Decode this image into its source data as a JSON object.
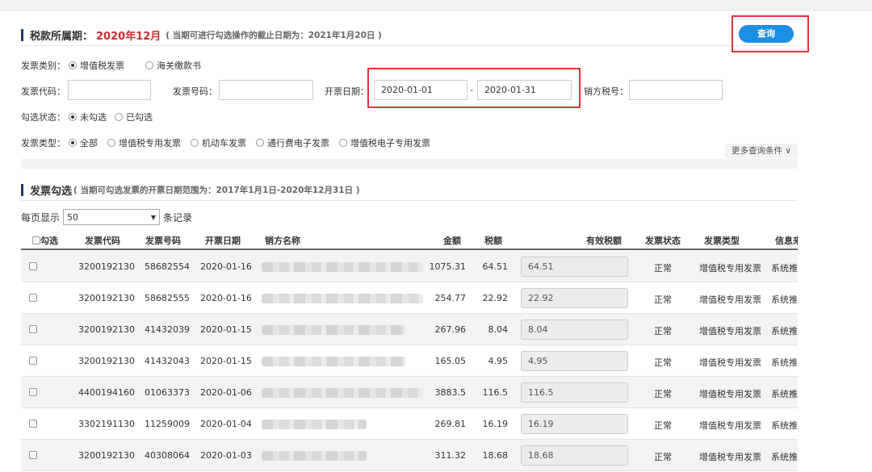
{
  "tax_period": {
    "label": "税款所属期：",
    "value": "2020年12月",
    "note": "( 当期可进行勾选操作的截止日期为：2021年1月20日 )"
  },
  "query_button": "查询",
  "filters": {
    "invoice_category": {
      "label": "发票类别：",
      "options": [
        "增值税发票",
        "海关缴款书"
      ],
      "selected": 0
    },
    "invoice_code": {
      "label": "发票代码：",
      "value": ""
    },
    "invoice_number": {
      "label": "发票号码：",
      "value": ""
    },
    "issue_date": {
      "label": "开票日期：",
      "from": "2020-01-01",
      "sep": "-",
      "to": "2020-01-31"
    },
    "seller_tax_id": {
      "label": "销方税号：",
      "value": ""
    },
    "check_status": {
      "label": "勾选状态：",
      "options": [
        "未勾选",
        "已勾选"
      ],
      "selected": 0
    },
    "invoice_type": {
      "label": "发票类型：",
      "options": [
        "全部",
        "增值税专用发票",
        "机动车发票",
        "通行费电子发票",
        "增值税电子专用发票"
      ],
      "selected": 0
    },
    "more_conditions": "更多查询条件 ∨"
  },
  "selection": {
    "title": "发票勾选",
    "note": "( 当期可勾选发票的开票日期范围为：2017年1月1日-2020年12月31日 )",
    "per_page_label": "每页显示",
    "per_page_value": "50",
    "per_page_suffix": "条记录"
  },
  "table": {
    "headers": [
      "勾选",
      "发票代码",
      "发票号码",
      "开票日期",
      "销方名称",
      "金额",
      "税额",
      "有效税额",
      "发票状态",
      "发票类型",
      "信息来"
    ],
    "rows": [
      {
        "code": "3200192130",
        "number": "58682554",
        "date": "2020-01-16",
        "amount": "1075.31",
        "tax": "64.51",
        "valid_tax": "64.51",
        "status": "正常",
        "type": "增值税专用发票",
        "source": "系统推"
      },
      {
        "code": "3200192130",
        "number": "58682555",
        "date": "2020-01-16",
        "amount": "254.77",
        "tax": "22.92",
        "valid_tax": "22.92",
        "status": "正常",
        "type": "增值税专用发票",
        "source": "系统推"
      },
      {
        "code": "3200192130",
        "number": "41432039",
        "date": "2020-01-15",
        "amount": "267.96",
        "tax": "8.04",
        "valid_tax": "8.04",
        "status": "正常",
        "type": "增值税专用发票",
        "source": "系统推"
      },
      {
        "code": "3200192130",
        "number": "41432043",
        "date": "2020-01-15",
        "amount": "165.05",
        "tax": "4.95",
        "valid_tax": "4.95",
        "status": "正常",
        "type": "增值税专用发票",
        "source": "系统推"
      },
      {
        "code": "4400194160",
        "number": "01063373",
        "date": "2020-01-06",
        "amount": "3883.5",
        "tax": "116.5",
        "valid_tax": "116.5",
        "status": "正常",
        "type": "增值税专用发票",
        "source": "系统推"
      },
      {
        "code": "3302191130",
        "number": "11259009",
        "date": "2020-01-04",
        "amount": "269.81",
        "tax": "16.19",
        "valid_tax": "16.19",
        "status": "正常",
        "type": "增值税专用发票",
        "source": "系统推"
      },
      {
        "code": "3200192130",
        "number": "40308064",
        "date": "2020-01-03",
        "amount": "311.32",
        "tax": "18.68",
        "valid_tax": "18.68",
        "status": "正常",
        "type": "增值税专用发票",
        "source": "系统推"
      }
    ]
  }
}
